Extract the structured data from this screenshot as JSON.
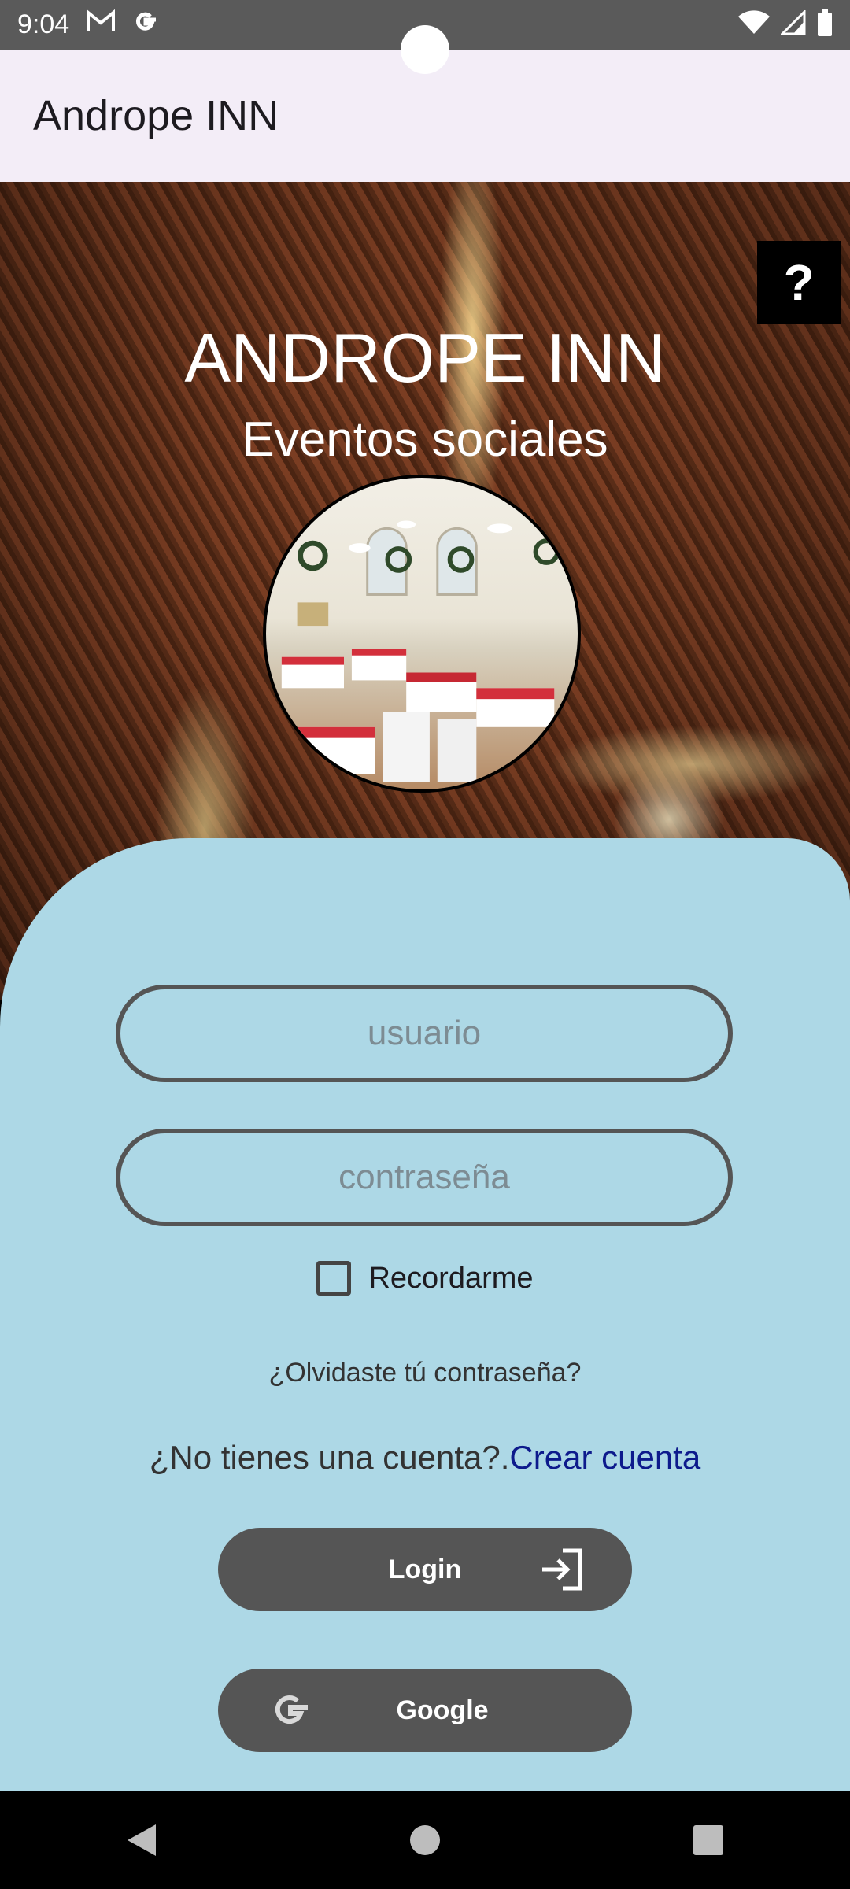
{
  "status_bar": {
    "time": "9:04",
    "notification_icons": [
      "gmail-icon",
      "google-icon"
    ],
    "system_icons": [
      "wifi-icon",
      "signal-icon",
      "battery-icon"
    ]
  },
  "app_bar": {
    "title": "Andrope INN"
  },
  "hero": {
    "help_label": "?",
    "title": "ANDROPE INN",
    "subtitle": "Eventos sociales"
  },
  "login": {
    "username_placeholder": "usuario",
    "password_placeholder": "contraseña",
    "remember_label": "Recordarme",
    "remember_checked": false,
    "forgot_password": "¿Olvidaste tú contraseña?",
    "no_account_text": "¿No tienes una cuenta?.",
    "create_account_link": "Crear cuenta",
    "login_button": "Login",
    "google_button": "Google"
  },
  "colors": {
    "panel_bg": "#add8e6",
    "button_bg": "#555555",
    "app_bar_bg": "#f3edf7",
    "link": "#0d1a8c"
  },
  "nav_bar": {
    "items": [
      "back-icon",
      "home-icon",
      "recents-icon"
    ]
  }
}
